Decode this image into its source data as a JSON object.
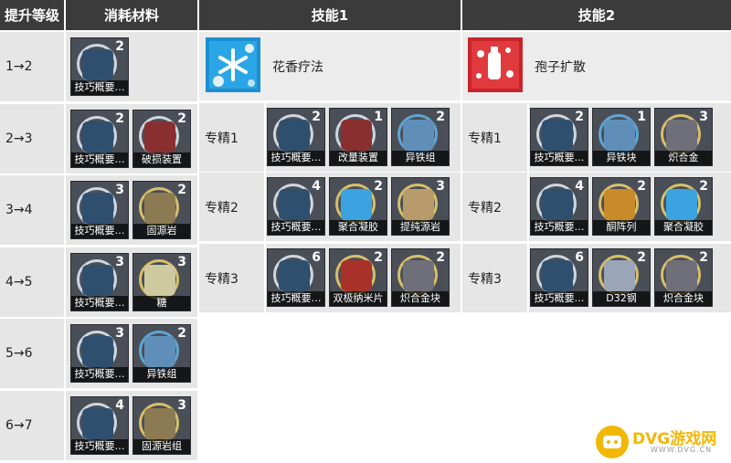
{
  "headers": {
    "level": "提升等级",
    "materials": "消耗材料",
    "skill1": "技能1",
    "skill2": "技能2"
  },
  "upgrade_rows": [
    {
      "level": "1→2",
      "items": [
        {
          "name": "技巧概要…",
          "count": "2"
        }
      ]
    },
    {
      "level": "2→3",
      "items": [
        {
          "name": "技巧概要…",
          "count": "2"
        },
        {
          "name": "破损装置",
          "count": "2"
        }
      ]
    },
    {
      "level": "3→4",
      "items": [
        {
          "name": "技巧概要…",
          "count": "3"
        },
        {
          "name": "固源岩",
          "count": "2"
        }
      ]
    },
    {
      "level": "4→5",
      "items": [
        {
          "name": "技巧概要…",
          "count": "3"
        },
        {
          "name": "糖",
          "count": "3"
        }
      ]
    },
    {
      "level": "5→6",
      "items": [
        {
          "name": "技巧概要…",
          "count": "3"
        },
        {
          "name": "异铁组",
          "count": "2"
        }
      ]
    },
    {
      "level": "6→7",
      "items": [
        {
          "name": "技巧概要…",
          "count": "4"
        },
        {
          "name": "固源岩组",
          "count": "3"
        }
      ]
    }
  ],
  "skill1": {
    "name": "花香疗法",
    "icon": "snowflake-flower-icon",
    "masteries": [
      {
        "label": "专精1",
        "items": [
          {
            "name": "技巧概要…",
            "count": "2"
          },
          {
            "name": "改量装置",
            "count": "1"
          },
          {
            "name": "异铁组",
            "count": "2"
          }
        ]
      },
      {
        "label": "专精2",
        "items": [
          {
            "name": "技巧概要…",
            "count": "4"
          },
          {
            "name": "聚合凝胶",
            "count": "2"
          },
          {
            "name": "提纯源岩",
            "count": "3"
          }
        ]
      },
      {
        "label": "专精3",
        "items": [
          {
            "name": "技巧概要…",
            "count": "6"
          },
          {
            "name": "双极纳米片",
            "count": "2"
          },
          {
            "name": "炽合金块",
            "count": "2"
          }
        ]
      }
    ]
  },
  "skill2": {
    "name": "孢子扩散",
    "icon": "spore-spray-icon",
    "masteries": [
      {
        "label": "专精1",
        "items": [
          {
            "name": "技巧概要…",
            "count": "2"
          },
          {
            "name": "异铁块",
            "count": "1"
          },
          {
            "name": "炽合金",
            "count": "3"
          }
        ]
      },
      {
        "label": "专精2",
        "items": [
          {
            "name": "技巧概要…",
            "count": "4"
          },
          {
            "name": "酮阵列",
            "count": "2"
          },
          {
            "name": "聚合凝胶",
            "count": "2"
          }
        ]
      },
      {
        "label": "专精3",
        "items": [
          {
            "name": "技巧概要…",
            "count": "6"
          },
          {
            "name": "D32钢",
            "count": "2"
          },
          {
            "name": "炽合金块",
            "count": "2"
          }
        ]
      }
    ]
  },
  "watermark": {
    "text": "DVG游戏网",
    "url": "WWW.DVG.CN"
  },
  "colors": {
    "header": "#3b3b3b",
    "row": "#e6e6e6",
    "skill_icon_blue": "#1d8fd0",
    "skill_icon_red": "#c8242b",
    "logo_yellow": "#f2b705"
  }
}
